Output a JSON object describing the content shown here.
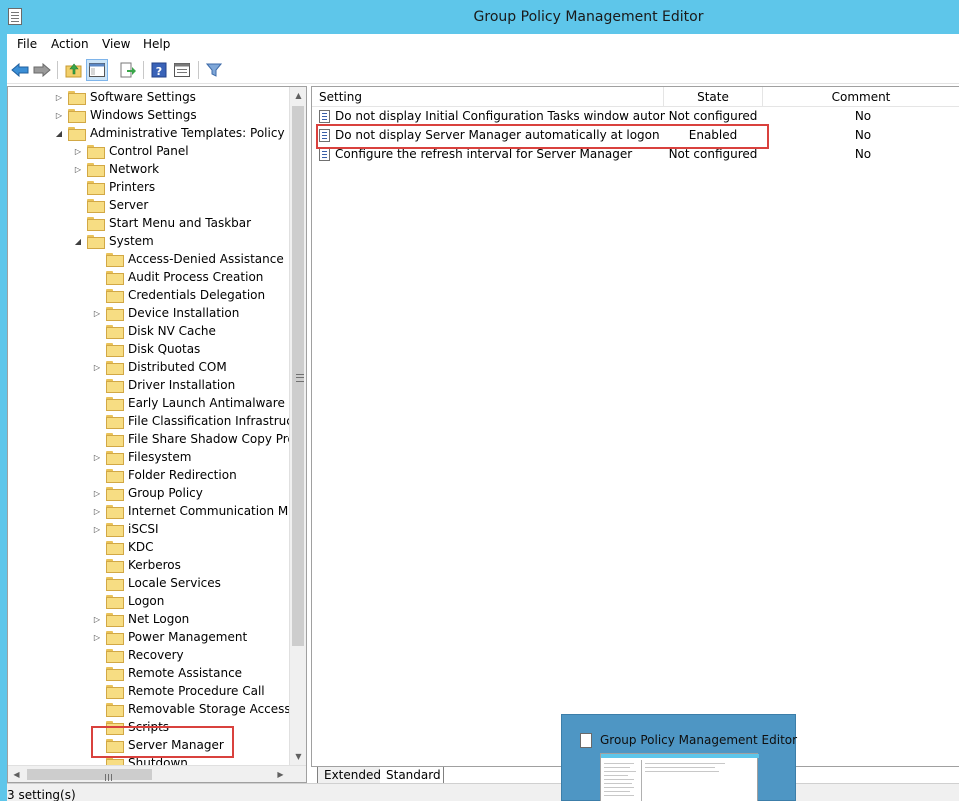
{
  "window": {
    "title": "Group Policy Management Editor"
  },
  "menu": {
    "file": "File",
    "action": "Action",
    "view": "View",
    "help": "Help"
  },
  "toolbar": {
    "back": "back-arrow-icon",
    "forward": "forward-arrow-icon",
    "up": "up-folder-icon",
    "show_hide_tree": "show-hide-console-tree-icon",
    "export": "export-list-icon",
    "help": "help-icon",
    "properties": "properties-icon",
    "filter": "filter-icon"
  },
  "tree": {
    "items": [
      {
        "label": "Software Settings",
        "expander": "▷"
      },
      {
        "label": "Windows Settings",
        "expander": "▷"
      },
      {
        "label": "Administrative Templates: Policy definitions",
        "expander": "◢"
      },
      {
        "label": "Control Panel",
        "expander": "▷"
      },
      {
        "label": "Network",
        "expander": "▷"
      },
      {
        "label": "Printers",
        "expander": ""
      },
      {
        "label": "Server",
        "expander": ""
      },
      {
        "label": "Start Menu and Taskbar",
        "expander": ""
      },
      {
        "label": "System",
        "expander": "◢"
      },
      {
        "label": "Access-Denied Assistance",
        "expander": ""
      },
      {
        "label": "Audit Process Creation",
        "expander": ""
      },
      {
        "label": "Credentials Delegation",
        "expander": ""
      },
      {
        "label": "Device Installation",
        "expander": "▷"
      },
      {
        "label": "Disk NV Cache",
        "expander": ""
      },
      {
        "label": "Disk Quotas",
        "expander": ""
      },
      {
        "label": "Distributed COM",
        "expander": "▷"
      },
      {
        "label": "Driver Installation",
        "expander": ""
      },
      {
        "label": "Early Launch Antimalware",
        "expander": ""
      },
      {
        "label": "File Classification Infrastructure",
        "expander": ""
      },
      {
        "label": "File Share Shadow Copy Provider",
        "expander": ""
      },
      {
        "label": "Filesystem",
        "expander": "▷"
      },
      {
        "label": "Folder Redirection",
        "expander": ""
      },
      {
        "label": "Group Policy",
        "expander": "▷"
      },
      {
        "label": "Internet Communication Management",
        "expander": "▷"
      },
      {
        "label": "iSCSI",
        "expander": "▷"
      },
      {
        "label": "KDC",
        "expander": ""
      },
      {
        "label": "Kerberos",
        "expander": ""
      },
      {
        "label": "Locale Services",
        "expander": ""
      },
      {
        "label": "Logon",
        "expander": ""
      },
      {
        "label": "Net Logon",
        "expander": "▷"
      },
      {
        "label": "Power Management",
        "expander": "▷"
      },
      {
        "label": "Recovery",
        "expander": ""
      },
      {
        "label": "Remote Assistance",
        "expander": ""
      },
      {
        "label": "Remote Procedure Call",
        "expander": ""
      },
      {
        "label": "Removable Storage Access",
        "expander": ""
      },
      {
        "label": "Scripts",
        "expander": ""
      },
      {
        "label": "Server Manager",
        "expander": ""
      },
      {
        "label": "Shutdown",
        "expander": ""
      }
    ]
  },
  "settings": {
    "headers": {
      "setting": "Setting",
      "state": "State",
      "comment": "Comment"
    },
    "rows": [
      {
        "name": "Do not display Initial Configuration Tasks window automati...",
        "state": "Not configured",
        "comment": "No"
      },
      {
        "name": "Do not display Server Manager automatically at logon",
        "state": "Enabled",
        "comment": "No"
      },
      {
        "name": "Configure the refresh interval for Server Manager",
        "state": "Not configured",
        "comment": "No"
      }
    ]
  },
  "tabs": {
    "extended": "Extended",
    "standard": "Standard"
  },
  "status": {
    "text": "3 setting(s)"
  },
  "thumbnail": {
    "title": "Group Policy Management Editor"
  },
  "colors": {
    "titlebar": "#5ec6ea",
    "highlight": "#d9413d",
    "thumbnail": "#4e96c4"
  }
}
